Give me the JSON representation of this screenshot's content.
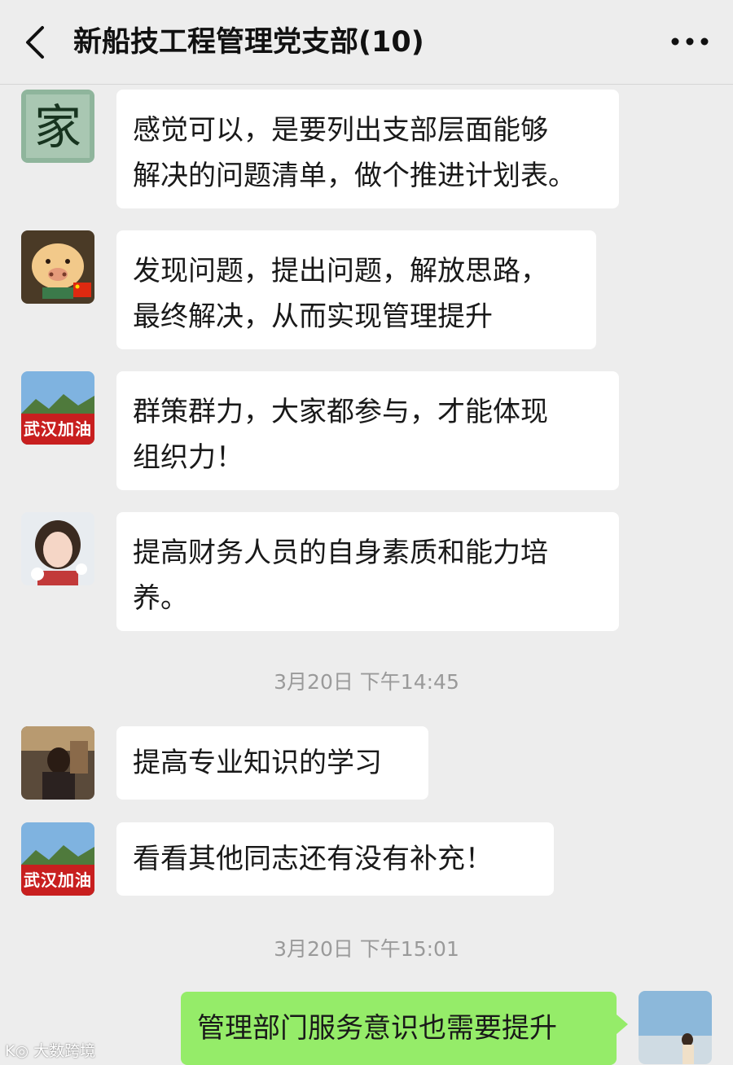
{
  "header": {
    "title": "新船技工程管理党支部(10)"
  },
  "messages": [
    {
      "text": "感觉可以，是要列出支部层面能够\n解决的问题清单，做个推进计划表。"
    },
    {
      "text": "发现问题，提出问题，解放思路，\n最终解决，从而实现管理提升"
    },
    {
      "text": "群策群力，大家都参与，才能体现\n组织力！"
    },
    {
      "text": "提高财务人员的自身素质和能力培\n养。"
    },
    {
      "text": "提高专业知识的学习"
    },
    {
      "text": "看看其他同志还有没有补充！"
    },
    {
      "text": "管理部门服务意识也需要提升"
    }
  ],
  "timestamps": [
    "3月20日 下午14:45",
    "3月20日 下午15:01"
  ],
  "avatars": {
    "calligraphy_char": "家",
    "badge_text": "武汉加油"
  },
  "watermark": "大数跨境",
  "colors": {
    "background": "#ededed",
    "bubble_incoming": "#ffffff",
    "bubble_outgoing": "#95ec69",
    "timestamp": "#9a9a9a"
  },
  "icons": {
    "back": "chevron-left-icon",
    "more": "more-dots-icon"
  }
}
